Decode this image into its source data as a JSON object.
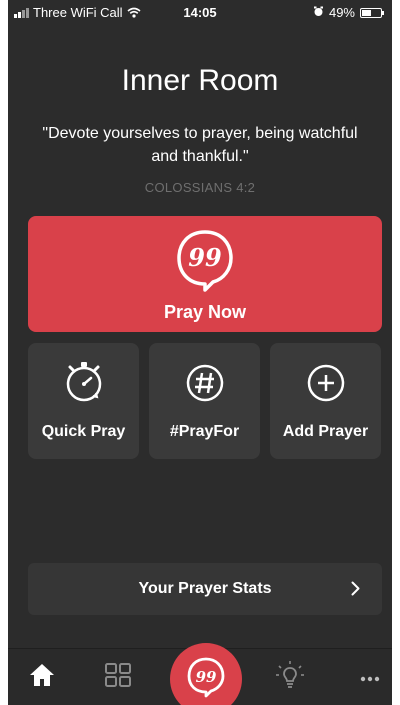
{
  "status_bar": {
    "carrier": "Three WiFi Call",
    "time": "14:05",
    "battery_text": "49%",
    "battery_level": 0.49
  },
  "header": {
    "title": "Inner Room",
    "verse": "\"Devote yourselves to prayer, being watchful and thankful.\"",
    "reference": "COLOSSIANS 4:2"
  },
  "pray_now": {
    "label": "Pray Now",
    "icon": "quote-bubble-icon",
    "color": "#d9414a"
  },
  "tiles": [
    {
      "label": "Quick Pray",
      "icon": "stopwatch-icon"
    },
    {
      "label": "#PrayFor",
      "icon": "hashtag-icon"
    },
    {
      "label": "Add Prayer",
      "icon": "plus-circle-icon"
    }
  ],
  "stats": {
    "label": "Your Prayer Stats",
    "icon": "chevron-right-icon"
  },
  "tab_bar": {
    "items": [
      {
        "name": "home",
        "icon": "home-icon",
        "active": true
      },
      {
        "name": "grid",
        "icon": "grid-icon"
      },
      {
        "name": "pray",
        "icon": "quote-bubble-icon"
      },
      {
        "name": "ideas",
        "icon": "lightbulb-icon"
      },
      {
        "name": "more",
        "icon": "more-icon"
      }
    ]
  },
  "colors": {
    "background": "#2c2c2c",
    "tile": "#3a3a3a",
    "accent": "#d9414a",
    "muted_text": "#6f6f6f"
  }
}
